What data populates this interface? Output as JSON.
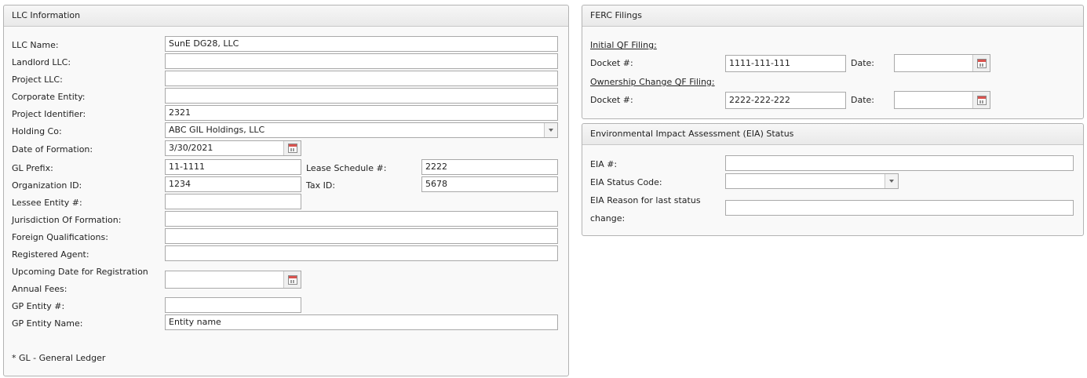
{
  "llc": {
    "title": "LLC Information",
    "llc_name_label": "LLC Name:",
    "llc_name_value": "SunE DG28, LLC",
    "landlord_label": "Landlord LLC:",
    "landlord_value": "",
    "project_llc_label": "Project LLC:",
    "project_llc_value": "",
    "corporate_label": "Corporate Entity:",
    "corporate_value": "",
    "project_identifier_label": "Project Identifier:",
    "project_identifier_value": "2321",
    "holding_label": "Holding Co:",
    "holding_value": "ABC GIL Holdings, LLC",
    "formation_date_label": "Date of Formation:",
    "formation_date_value": "3/30/2021",
    "gl_prefix_label": "GL Prefix:",
    "gl_prefix_value": "11-1111",
    "lease_schedule_label": "Lease Schedule #:",
    "lease_schedule_value": "2222",
    "org_id_label": "Organization ID:",
    "org_id_value": "1234",
    "tax_id_label": "Tax ID:",
    "tax_id_value": "5678",
    "lessee_label": "Lessee Entity #:",
    "lessee_value": "",
    "jurisdiction_label": "Jurisdiction Of Formation:",
    "jurisdiction_value": "",
    "foreign_label": "Foreign Qualifications:",
    "foreign_value": "",
    "registered_agent_label": "Registered Agent:",
    "registered_agent_value": "",
    "upcoming_label_1": "Upcoming Date for Registration",
    "upcoming_label_2": "Annual Fees:",
    "upcoming_value": "",
    "gp_entity_num_label": "GP Entity #:",
    "gp_entity_num_value": "",
    "gp_entity_name_label": "GP Entity Name:",
    "gp_entity_name_value": "Entity name",
    "footnote": "* GL - General Ledger"
  },
  "ferc": {
    "title": "FERC Filings",
    "initial_link": "Initial QF Filing:",
    "docket_label": "Docket #:",
    "initial_docket_value": "1111-111-111",
    "date_label": "Date:",
    "initial_date_value": "",
    "ownership_link": "Ownership Change QF Filing:",
    "ownership_docket_value": "2222-222-222",
    "ownership_date_value": ""
  },
  "eia": {
    "title": "Environmental Impact Assessment (EIA) Status",
    "eia_num_label": "EIA #:",
    "eia_num_value": "",
    "status_code_label": "EIA Status Code:",
    "status_code_value": "",
    "reason_label_1": "EIA Reason for last status",
    "reason_label_2": "change:",
    "reason_value": ""
  },
  "icons": {
    "calendar": "calendar-icon",
    "dropdown": "chevron-down-icon"
  }
}
